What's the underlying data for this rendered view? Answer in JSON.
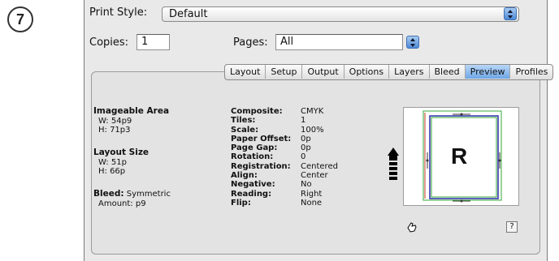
{
  "step_badge": "7",
  "print_style": {
    "label": "Print Style:",
    "value": "Default"
  },
  "copies": {
    "label": "Copies:",
    "value": "1"
  },
  "pages": {
    "label": "Pages:",
    "value": "All"
  },
  "tabs": [
    {
      "label": "Layout",
      "active": false
    },
    {
      "label": "Setup",
      "active": false
    },
    {
      "label": "Output",
      "active": false
    },
    {
      "label": "Options",
      "active": false
    },
    {
      "label": "Layers",
      "active": false
    },
    {
      "label": "Bleed",
      "active": false
    },
    {
      "label": "Preview",
      "active": true
    },
    {
      "label": "Profiles",
      "active": false
    }
  ],
  "imageable_area": {
    "heading": "Imageable Area",
    "w": "W: 54p9",
    "h": "H: 71p3"
  },
  "layout_size": {
    "heading": "Layout Size",
    "w": "W: 51p",
    "h": "H: 66p"
  },
  "bleed": {
    "label": "Bleed:",
    "value": "Symmetric",
    "amount": "Amount: p9"
  },
  "settings": [
    {
      "key": "Composite:",
      "value": "CMYK"
    },
    {
      "key": "Tiles:",
      "value": "1"
    },
    {
      "key": "Scale:",
      "value": "100%"
    },
    {
      "key": "Paper Offset:",
      "value": "0p"
    },
    {
      "key": "Page Gap:",
      "value": "0p"
    },
    {
      "key": "Rotation:",
      "value": "0"
    },
    {
      "key": "Registration:",
      "value": "Centered"
    },
    {
      "key": "Align:",
      "value": "Center"
    },
    {
      "key": "Negative:",
      "value": "No"
    },
    {
      "key": "Reading:",
      "value": "Right"
    },
    {
      "key": "Flip:",
      "value": "None"
    }
  ],
  "preview": {
    "page_letter": "R",
    "help_label": "?"
  },
  "colors": {
    "accent": "#5d98e0",
    "bleed_line": "#36a83a",
    "page_border": "#2d2da6",
    "margin_line": "#d23a2a"
  }
}
